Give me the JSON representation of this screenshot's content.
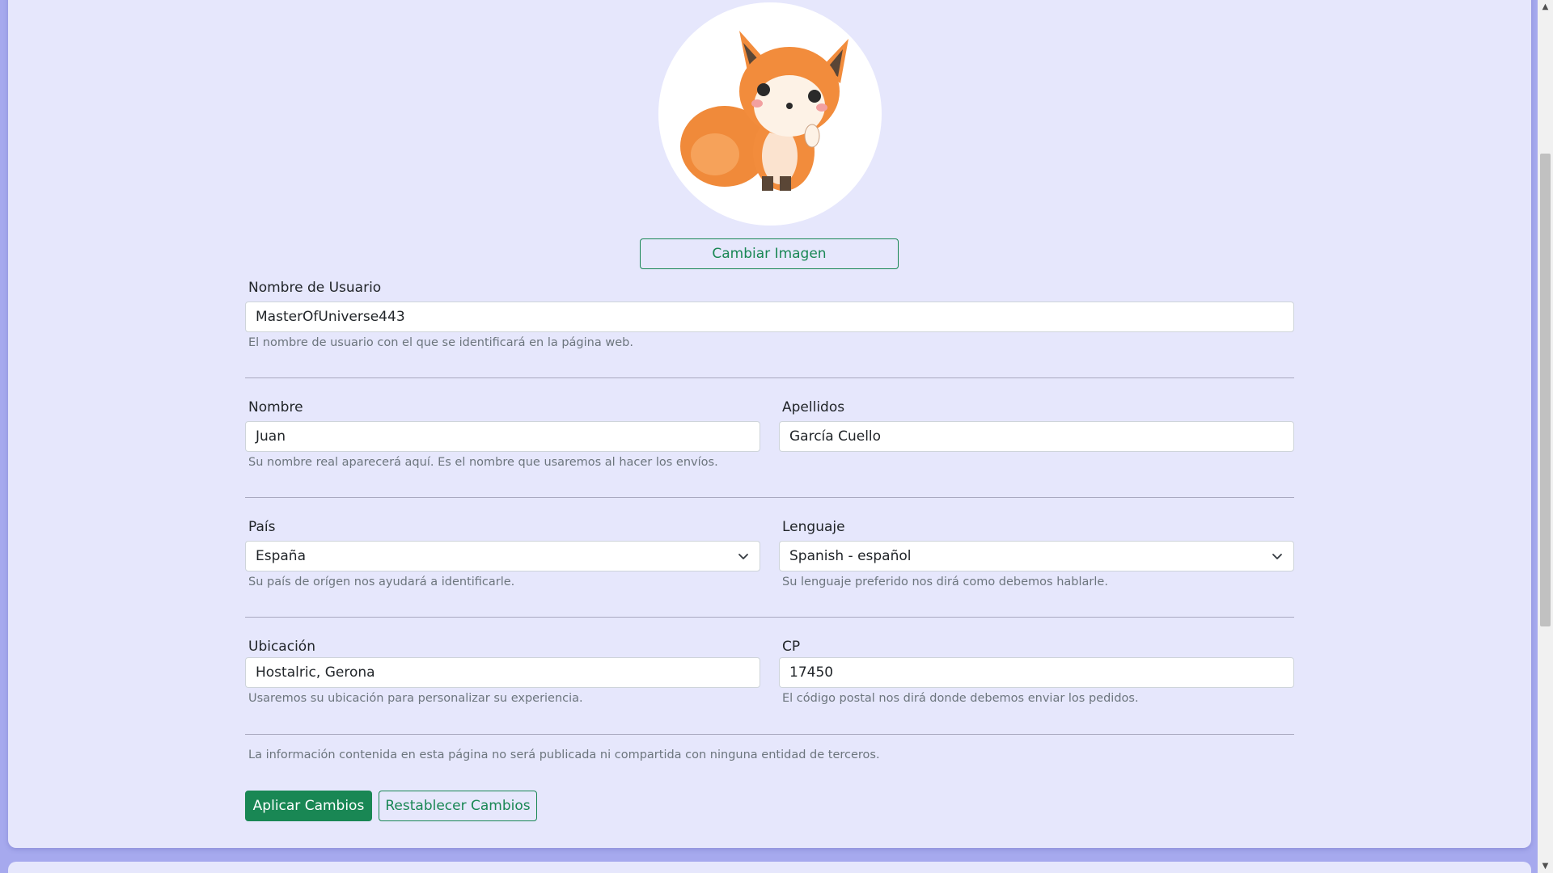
{
  "avatar": {
    "alt": "fox-illustration"
  },
  "change_image_label": "Cambiar Imagen",
  "username": {
    "label": "Nombre de Usuario",
    "value": "MasterOfUniverse443",
    "help": "El nombre de usuario con el que se identificará en la página web."
  },
  "name": {
    "label": "Nombre",
    "value": "Juan",
    "help": "Su nombre real aparecerá aquí. Es el nombre que usaremos al hacer los envíos."
  },
  "surname": {
    "label": "Apellidos",
    "value": "García Cuello"
  },
  "country": {
    "label": "País",
    "selected": "España",
    "help": "Su país de orígen nos ayudará a identificarle."
  },
  "language": {
    "label": "Lenguaje",
    "selected": "Spanish - español",
    "help": "Su lenguaje preferido nos dirá como debemos hablarle."
  },
  "location": {
    "label": "Ubicación",
    "value": "Hostalric, Gerona",
    "help": "Usaremos su ubicación para personalizar su experiencia."
  },
  "postal_code": {
    "label": "CP",
    "value": "17450",
    "help": "El código postal nos dirá donde debemos enviar los pedidos."
  },
  "privacy_note": "La información contenida en esta página no será publicada ni compartida con ninguna entidad de terceros.",
  "actions": {
    "apply_label": "Aplicar Cambios",
    "reset_label": "Restablecer Cambios"
  },
  "colors": {
    "accent": "#198754",
    "background": "#a6a9ee",
    "card": "#e6e7fc"
  }
}
